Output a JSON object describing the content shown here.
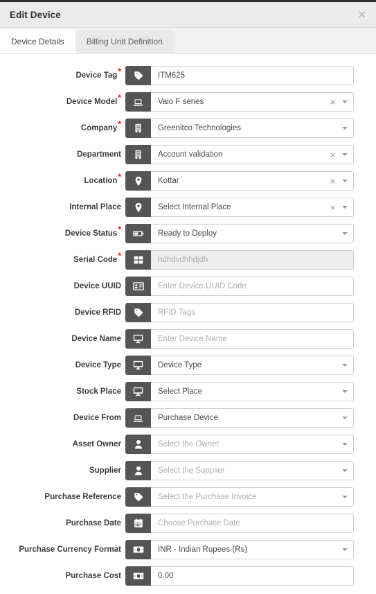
{
  "modal": {
    "title": "Edit Device",
    "close_label": "×",
    "close_icon": "close-icon"
  },
  "tabs": [
    {
      "id": "device-details",
      "label": "Device Details",
      "active": true
    },
    {
      "id": "billing-unit-definition",
      "label": "Billing Unit Definition",
      "active": false
    }
  ],
  "adornments": {
    "clear_label": "×",
    "clear_icon": "clear-icon",
    "caret_icon": "chevron-down-icon"
  },
  "form": {
    "fields": [
      {
        "name": "device-tag",
        "label": "Device Tag",
        "required": true,
        "icon": "tag-icon",
        "value": "ITM625",
        "is_placeholder": false,
        "control": "text",
        "disabled": false,
        "has_clear": false,
        "has_caret": false
      },
      {
        "name": "device-model",
        "label": "Device Model",
        "required": true,
        "icon": "laptop-icon",
        "value": "Vaio F series",
        "is_placeholder": false,
        "control": "select",
        "disabled": false,
        "has_clear": true,
        "has_caret": true
      },
      {
        "name": "company",
        "label": "Company",
        "required": true,
        "icon": "building-icon",
        "value": "Greenitco Technologies",
        "is_placeholder": false,
        "control": "select",
        "disabled": false,
        "has_clear": false,
        "has_caret": true
      },
      {
        "name": "department",
        "label": "Department",
        "required": false,
        "icon": "building-icon",
        "value": "Account validation",
        "is_placeholder": false,
        "control": "select",
        "disabled": false,
        "has_clear": true,
        "has_caret": true
      },
      {
        "name": "location",
        "label": "Location",
        "required": true,
        "icon": "map-marker-icon",
        "value": "Kottar",
        "is_placeholder": false,
        "control": "select",
        "disabled": false,
        "has_clear": true,
        "has_caret": true
      },
      {
        "name": "internal-place",
        "label": "Internal Place",
        "required": false,
        "icon": "map-marker-icon",
        "value": "Select Internal Place",
        "is_placeholder": false,
        "control": "select",
        "disabled": false,
        "has_clear": true,
        "has_caret": true
      },
      {
        "name": "device-status",
        "label": "Device Status",
        "required": true,
        "icon": "battery-icon",
        "value": "Ready to Deploy",
        "is_placeholder": false,
        "control": "select",
        "disabled": false,
        "has_clear": false,
        "has_caret": true
      },
      {
        "name": "serial-code",
        "label": "Serial Code",
        "required": true,
        "icon": "grid-icon",
        "value": "hdhdvdhhdjdh",
        "is_placeholder": true,
        "control": "text",
        "disabled": true,
        "has_clear": false,
        "has_caret": false
      },
      {
        "name": "device-uuid",
        "label": "Device UUID",
        "required": false,
        "icon": "id-card-icon",
        "value": "Enter Device UUID Code",
        "is_placeholder": true,
        "control": "text",
        "disabled": false,
        "has_clear": false,
        "has_caret": false
      },
      {
        "name": "device-rfid",
        "label": "Device RFID",
        "required": false,
        "icon": "tag-icon",
        "value": "RFID Tags",
        "is_placeholder": true,
        "control": "text",
        "disabled": false,
        "has_clear": false,
        "has_caret": false
      },
      {
        "name": "device-name",
        "label": "Device Name",
        "required": false,
        "icon": "desktop-icon",
        "value": "Enter Device Name",
        "is_placeholder": true,
        "control": "text",
        "disabled": false,
        "has_clear": false,
        "has_caret": false
      },
      {
        "name": "device-type",
        "label": "Device Type",
        "required": false,
        "icon": "desktop-icon",
        "value": "Device Type",
        "is_placeholder": false,
        "control": "select",
        "disabled": false,
        "has_clear": false,
        "has_caret": true
      },
      {
        "name": "stock-place",
        "label": "Stock Place",
        "required": false,
        "icon": "desktop-icon",
        "value": "Select Place",
        "is_placeholder": false,
        "control": "select",
        "disabled": false,
        "has_clear": false,
        "has_caret": true
      },
      {
        "name": "device-from",
        "label": "Device From",
        "required": false,
        "icon": "laptop-icon",
        "value": "Purchase Device",
        "is_placeholder": false,
        "control": "select",
        "disabled": false,
        "has_clear": false,
        "has_caret": true
      },
      {
        "name": "asset-owner",
        "label": "Asset Owner",
        "required": false,
        "icon": "user-icon",
        "value": "Select the Owner",
        "is_placeholder": true,
        "control": "select",
        "disabled": false,
        "has_clear": false,
        "has_caret": true
      },
      {
        "name": "supplier",
        "label": "Supplier",
        "required": false,
        "icon": "user-icon",
        "value": "Select the Supplier",
        "is_placeholder": true,
        "control": "select",
        "disabled": false,
        "has_clear": false,
        "has_caret": true
      },
      {
        "name": "purchase-reference",
        "label": "Purchase Reference",
        "required": false,
        "icon": "tag-icon",
        "value": "Select the Purchase Invoice",
        "is_placeholder": true,
        "control": "select",
        "disabled": false,
        "has_clear": false,
        "has_caret": true
      },
      {
        "name": "purchase-date",
        "label": "Purchase Date",
        "required": false,
        "icon": "calendar-icon",
        "value": "Choose Purchase Date",
        "is_placeholder": true,
        "control": "date",
        "disabled": false,
        "has_clear": false,
        "has_caret": false
      },
      {
        "name": "purchase-currency-format",
        "label": "Purchase Currency Format",
        "required": false,
        "icon": "money-icon",
        "value": "INR - Indian Rupees (Rs)",
        "is_placeholder": false,
        "control": "select",
        "disabled": false,
        "has_clear": false,
        "has_caret": true
      },
      {
        "name": "purchase-cost",
        "label": "Purchase Cost",
        "required": false,
        "icon": "money-icon",
        "value": "0.00",
        "is_placeholder": false,
        "control": "text",
        "disabled": false,
        "has_clear": false,
        "has_caret": false
      }
    ]
  },
  "colors": {
    "icon_box": "#555555",
    "header_bg": "#ebebeb",
    "required_asterisk": "#ff0000",
    "border": "#cfcfcf",
    "disabled_bg": "#eeeeee"
  }
}
